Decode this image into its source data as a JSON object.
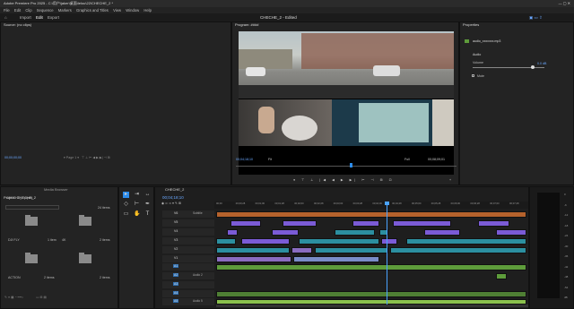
{
  "app": {
    "title": "Adobe Premiere Pro 2025 - C:\\用户\\jaker\\桌面\\lelou\\22\\CHECHE_2 *"
  },
  "menu": [
    "File",
    "Edit",
    "Clip",
    "Sequence",
    "Markers",
    "Graphics and Titles",
    "View",
    "Window",
    "Help"
  ],
  "workspace": {
    "tabs": [
      "Import",
      "Edit",
      "Export"
    ],
    "title": "CHECHE_2 - Edited"
  },
  "source": {
    "tab": "Source: (no clips)",
    "timecode": "00;00;00;00"
  },
  "program": {
    "tab": "Program: ####",
    "timecode": "00;04;18;10",
    "fit": "Fit",
    "quality": "Full",
    "duration": "00;08;09;01"
  },
  "properties": {
    "tab": "Properties",
    "clip": "audio_xxxxxxx.mp3",
    "section": "Audio",
    "volume_label": "Volume",
    "volume_value": "0.0 dB",
    "mute_label": "Mute"
  },
  "project": {
    "tabs": [
      "Project: CHECHE_2",
      "Media Browser"
    ],
    "name": "CHECHE_2.prproj",
    "count": "24 items",
    "bins": [
      {
        "name": "",
        "items": ""
      },
      {
        "name": "",
        "items": "2 items"
      },
      {
        "name": "DJI FLY",
        "items": "1 item"
      },
      {
        "name": "4K",
        "items": "2 items"
      },
      {
        "name": "ACTION",
        "items": "2 items"
      },
      {
        "name": "",
        "items": "2 items"
      }
    ]
  },
  "timeline": {
    "tab": "CHECHE_2",
    "timecode": "00;04;18;10",
    "rulers": [
      "00;00",
      "00;00;28",
      "00;01;00",
      "00;01;28",
      "00;02;00",
      "00;02;28",
      "00;03;00",
      "00;03;28",
      "00;04;00",
      "00;04;28",
      "00;05;00",
      "00;05;28",
      "00;06;00",
      "00;06;28",
      "00;07;00",
      "00;07;28"
    ],
    "tracks": [
      {
        "name": "V6",
        "label": "Subtitle"
      },
      {
        "name": "V5",
        "label": ""
      },
      {
        "name": "V4",
        "label": ""
      },
      {
        "name": "V3",
        "label": ""
      },
      {
        "name": "V2",
        "label": ""
      },
      {
        "name": "V1",
        "label": ""
      },
      {
        "name": "A1",
        "label": ""
      },
      {
        "name": "A2",
        "label": "Audio 2"
      },
      {
        "name": "A3",
        "label": ""
      },
      {
        "name": "A4",
        "label": ""
      },
      {
        "name": "A5",
        "label": "Audio 5"
      }
    ]
  },
  "meter": {
    "scale": [
      "0",
      "-6",
      "-12",
      "-18",
      "-24",
      "-30",
      "-36",
      "-42",
      "-48",
      "-54",
      "dB"
    ]
  },
  "colors": {
    "accent": "#2d8ceb",
    "v6": "#b5622c",
    "purple": "#7b5bd6",
    "teal": "#2c8fa0",
    "audio": "#5e9c3b"
  }
}
